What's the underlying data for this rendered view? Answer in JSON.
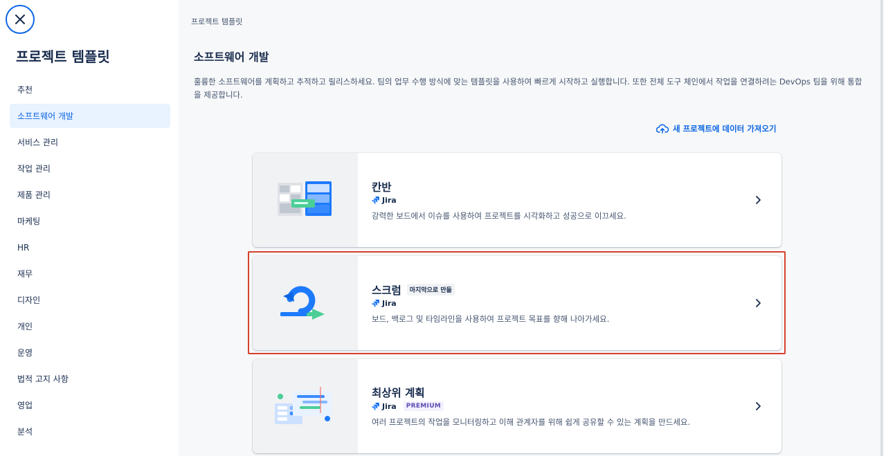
{
  "sidebar": {
    "title": "프로젝트 템플릿",
    "items": [
      {
        "label": "추천",
        "active": false
      },
      {
        "label": "소프트웨어 개발",
        "active": true
      },
      {
        "label": "서비스 관리",
        "active": false
      },
      {
        "label": "작업 관리",
        "active": false
      },
      {
        "label": "제품 관리",
        "active": false
      },
      {
        "label": "마케팅",
        "active": false
      },
      {
        "label": "HR",
        "active": false
      },
      {
        "label": "재무",
        "active": false
      },
      {
        "label": "디자인",
        "active": false
      },
      {
        "label": "개인",
        "active": false
      },
      {
        "label": "운영",
        "active": false
      },
      {
        "label": "법적 고지 사항",
        "active": false
      },
      {
        "label": "영업",
        "active": false
      },
      {
        "label": "분석",
        "active": false
      }
    ]
  },
  "main": {
    "breadcrumb": "프로젝트 템플릿",
    "heading": "소프트웨어 개발",
    "description": "훌륭한 소프트웨어를 계획하고 추적하고 릴리스하세요. 팀의 업무 수행 방식에 맞는 템플릿을 사용하여 빠르게 시작하고 실행합니다. 또한 전체 도구 체인에서 작업을 연결하려는 DevOps 팀을 위해 통합을 제공합니다.",
    "import_link": "새 프로젝트에 데이터 가져오기"
  },
  "cards": [
    {
      "title": "칸반",
      "product": "Jira",
      "description": "강력한 보드에서 이슈를 사용하여 프로젝트를 시각화하고 성공으로 이끄세요."
    },
    {
      "title": "스크럼",
      "badge": "마지막으로 만듦",
      "product": "Jira",
      "description": "보드, 백로그 및 타임라인을 사용하여 프로젝트 목표를 향해 나아가세요."
    },
    {
      "title": "최상위 계획",
      "product": "Jira",
      "premium": "PREMIUM",
      "description": "여러 프로젝트의 작업을 모니터링하고 이해 관계자를 위해 쉽게 공유할 수 있는 계획을 만드세요."
    }
  ],
  "colors": {
    "brand": "#0c66e4",
    "highlight": "#d6402e",
    "active_bg": "#e9f2ff"
  }
}
